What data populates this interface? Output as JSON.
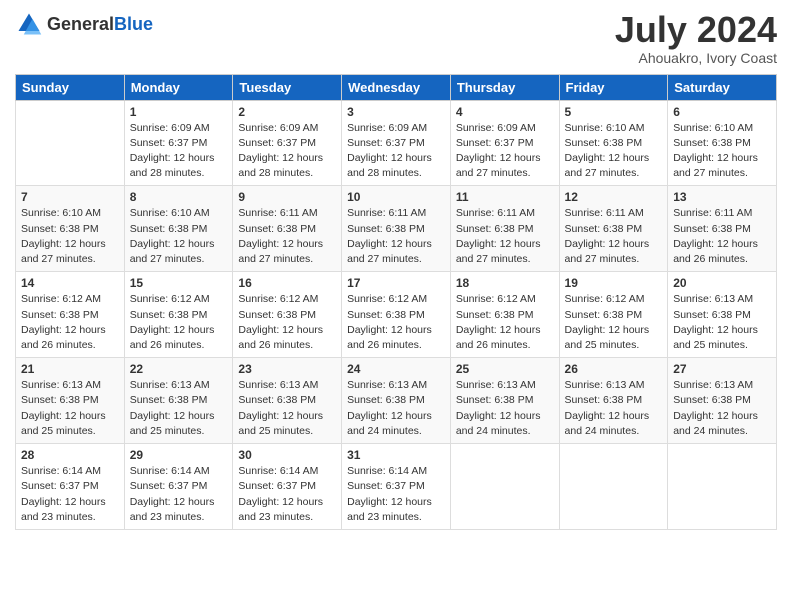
{
  "logo": {
    "general": "General",
    "blue": "Blue"
  },
  "title": {
    "month_year": "July 2024",
    "location": "Ahouakro, Ivory Coast"
  },
  "weekdays": [
    "Sunday",
    "Monday",
    "Tuesday",
    "Wednesday",
    "Thursday",
    "Friday",
    "Saturday"
  ],
  "weeks": [
    [
      {
        "day": "",
        "sunrise": "",
        "sunset": "",
        "daylight": ""
      },
      {
        "day": "1",
        "sunrise": "Sunrise: 6:09 AM",
        "sunset": "Sunset: 6:37 PM",
        "daylight": "Daylight: 12 hours and 28 minutes."
      },
      {
        "day": "2",
        "sunrise": "Sunrise: 6:09 AM",
        "sunset": "Sunset: 6:37 PM",
        "daylight": "Daylight: 12 hours and 28 minutes."
      },
      {
        "day": "3",
        "sunrise": "Sunrise: 6:09 AM",
        "sunset": "Sunset: 6:37 PM",
        "daylight": "Daylight: 12 hours and 28 minutes."
      },
      {
        "day": "4",
        "sunrise": "Sunrise: 6:09 AM",
        "sunset": "Sunset: 6:37 PM",
        "daylight": "Daylight: 12 hours and 27 minutes."
      },
      {
        "day": "5",
        "sunrise": "Sunrise: 6:10 AM",
        "sunset": "Sunset: 6:38 PM",
        "daylight": "Daylight: 12 hours and 27 minutes."
      },
      {
        "day": "6",
        "sunrise": "Sunrise: 6:10 AM",
        "sunset": "Sunset: 6:38 PM",
        "daylight": "Daylight: 12 hours and 27 minutes."
      }
    ],
    [
      {
        "day": "7",
        "sunrise": "Sunrise: 6:10 AM",
        "sunset": "Sunset: 6:38 PM",
        "daylight": "Daylight: 12 hours and 27 minutes."
      },
      {
        "day": "8",
        "sunrise": "Sunrise: 6:10 AM",
        "sunset": "Sunset: 6:38 PM",
        "daylight": "Daylight: 12 hours and 27 minutes."
      },
      {
        "day": "9",
        "sunrise": "Sunrise: 6:11 AM",
        "sunset": "Sunset: 6:38 PM",
        "daylight": "Daylight: 12 hours and 27 minutes."
      },
      {
        "day": "10",
        "sunrise": "Sunrise: 6:11 AM",
        "sunset": "Sunset: 6:38 PM",
        "daylight": "Daylight: 12 hours and 27 minutes."
      },
      {
        "day": "11",
        "sunrise": "Sunrise: 6:11 AM",
        "sunset": "Sunset: 6:38 PM",
        "daylight": "Daylight: 12 hours and 27 minutes."
      },
      {
        "day": "12",
        "sunrise": "Sunrise: 6:11 AM",
        "sunset": "Sunset: 6:38 PM",
        "daylight": "Daylight: 12 hours and 27 minutes."
      },
      {
        "day": "13",
        "sunrise": "Sunrise: 6:11 AM",
        "sunset": "Sunset: 6:38 PM",
        "daylight": "Daylight: 12 hours and 26 minutes."
      }
    ],
    [
      {
        "day": "14",
        "sunrise": "Sunrise: 6:12 AM",
        "sunset": "Sunset: 6:38 PM",
        "daylight": "Daylight: 12 hours and 26 minutes."
      },
      {
        "day": "15",
        "sunrise": "Sunrise: 6:12 AM",
        "sunset": "Sunset: 6:38 PM",
        "daylight": "Daylight: 12 hours and 26 minutes."
      },
      {
        "day": "16",
        "sunrise": "Sunrise: 6:12 AM",
        "sunset": "Sunset: 6:38 PM",
        "daylight": "Daylight: 12 hours and 26 minutes."
      },
      {
        "day": "17",
        "sunrise": "Sunrise: 6:12 AM",
        "sunset": "Sunset: 6:38 PM",
        "daylight": "Daylight: 12 hours and 26 minutes."
      },
      {
        "day": "18",
        "sunrise": "Sunrise: 6:12 AM",
        "sunset": "Sunset: 6:38 PM",
        "daylight": "Daylight: 12 hours and 26 minutes."
      },
      {
        "day": "19",
        "sunrise": "Sunrise: 6:12 AM",
        "sunset": "Sunset: 6:38 PM",
        "daylight": "Daylight: 12 hours and 25 minutes."
      },
      {
        "day": "20",
        "sunrise": "Sunrise: 6:13 AM",
        "sunset": "Sunset: 6:38 PM",
        "daylight": "Daylight: 12 hours and 25 minutes."
      }
    ],
    [
      {
        "day": "21",
        "sunrise": "Sunrise: 6:13 AM",
        "sunset": "Sunset: 6:38 PM",
        "daylight": "Daylight: 12 hours and 25 minutes."
      },
      {
        "day": "22",
        "sunrise": "Sunrise: 6:13 AM",
        "sunset": "Sunset: 6:38 PM",
        "daylight": "Daylight: 12 hours and 25 minutes."
      },
      {
        "day": "23",
        "sunrise": "Sunrise: 6:13 AM",
        "sunset": "Sunset: 6:38 PM",
        "daylight": "Daylight: 12 hours and 25 minutes."
      },
      {
        "day": "24",
        "sunrise": "Sunrise: 6:13 AM",
        "sunset": "Sunset: 6:38 PM",
        "daylight": "Daylight: 12 hours and 24 minutes."
      },
      {
        "day": "25",
        "sunrise": "Sunrise: 6:13 AM",
        "sunset": "Sunset: 6:38 PM",
        "daylight": "Daylight: 12 hours and 24 minutes."
      },
      {
        "day": "26",
        "sunrise": "Sunrise: 6:13 AM",
        "sunset": "Sunset: 6:38 PM",
        "daylight": "Daylight: 12 hours and 24 minutes."
      },
      {
        "day": "27",
        "sunrise": "Sunrise: 6:13 AM",
        "sunset": "Sunset: 6:38 PM",
        "daylight": "Daylight: 12 hours and 24 minutes."
      }
    ],
    [
      {
        "day": "28",
        "sunrise": "Sunrise: 6:14 AM",
        "sunset": "Sunset: 6:37 PM",
        "daylight": "Daylight: 12 hours and 23 minutes."
      },
      {
        "day": "29",
        "sunrise": "Sunrise: 6:14 AM",
        "sunset": "Sunset: 6:37 PM",
        "daylight": "Daylight: 12 hours and 23 minutes."
      },
      {
        "day": "30",
        "sunrise": "Sunrise: 6:14 AM",
        "sunset": "Sunset: 6:37 PM",
        "daylight": "Daylight: 12 hours and 23 minutes."
      },
      {
        "day": "31",
        "sunrise": "Sunrise: 6:14 AM",
        "sunset": "Sunset: 6:37 PM",
        "daylight": "Daylight: 12 hours and 23 minutes."
      },
      {
        "day": "",
        "sunrise": "",
        "sunset": "",
        "daylight": ""
      },
      {
        "day": "",
        "sunrise": "",
        "sunset": "",
        "daylight": ""
      },
      {
        "day": "",
        "sunrise": "",
        "sunset": "",
        "daylight": ""
      }
    ]
  ]
}
